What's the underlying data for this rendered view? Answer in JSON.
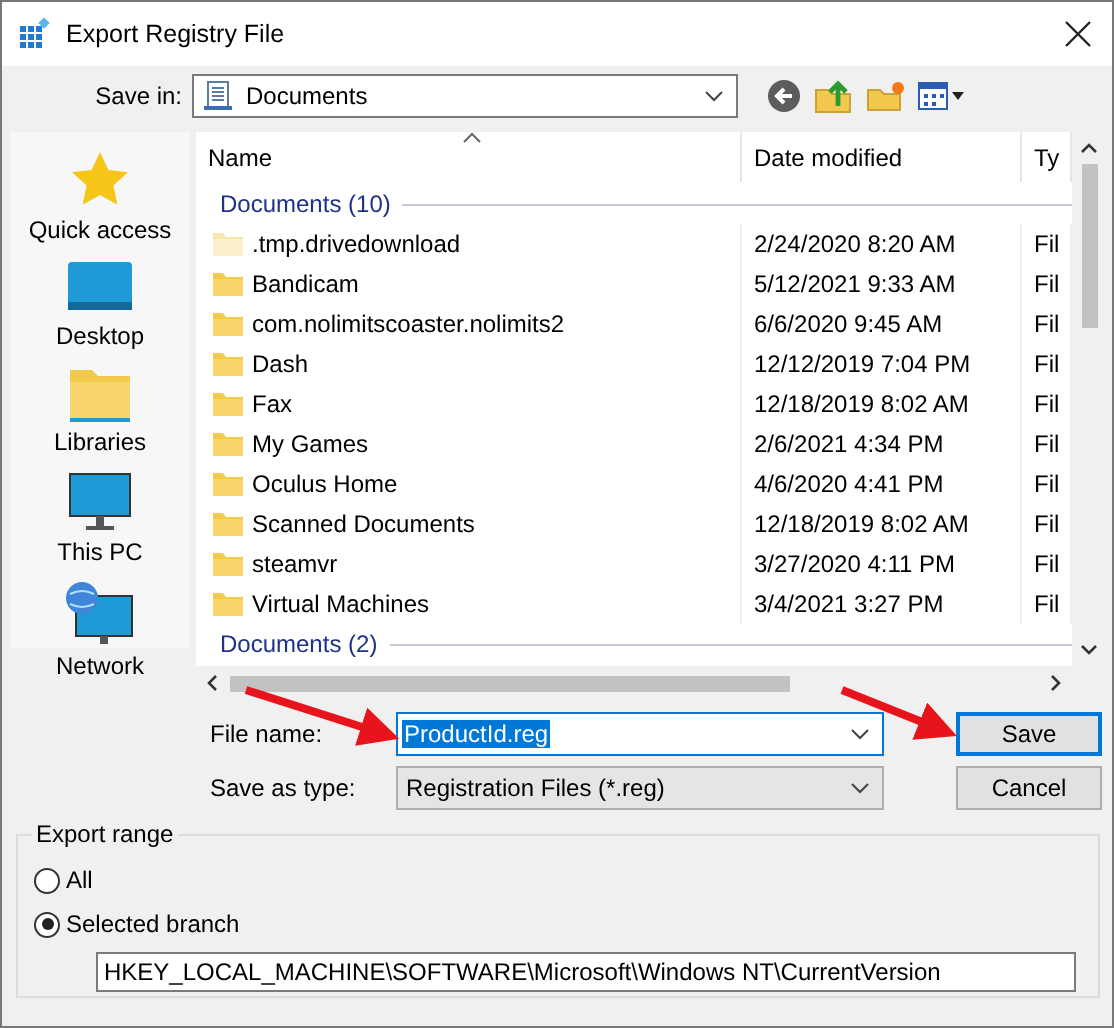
{
  "window": {
    "title": "Export Registry File"
  },
  "save_in": {
    "label": "Save in:",
    "value": "Documents"
  },
  "sidebar": {
    "items": [
      {
        "label": "Quick access",
        "kind": "star"
      },
      {
        "label": "Desktop",
        "kind": "desktop"
      },
      {
        "label": "Libraries",
        "kind": "library"
      },
      {
        "label": "This PC",
        "kind": "pc"
      },
      {
        "label": "Network",
        "kind": "network"
      }
    ]
  },
  "table": {
    "columns": [
      "Name",
      "Date modified",
      "Ty"
    ],
    "rows": [
      {
        "kind": "group",
        "name": "Documents (10)"
      },
      {
        "kind": "folder",
        "hidden": true,
        "name": ".tmp.drivedownload",
        "date": "2/24/2020 8:20 AM",
        "column_3": "Fil"
      },
      {
        "kind": "folder",
        "hidden": false,
        "name": "Bandicam",
        "date": "5/12/2021 9:33 AM",
        "column_3": "Fil"
      },
      {
        "kind": "folder",
        "hidden": false,
        "name": "com.nolimitscoaster.nolimits2",
        "date": "6/6/2020 9:45 AM",
        "column_3": "Fil"
      },
      {
        "kind": "folder",
        "hidden": false,
        "name": "Dash",
        "date": "12/12/2019 7:04 PM",
        "column_3": "Fil"
      },
      {
        "kind": "folder",
        "hidden": false,
        "name": "Fax",
        "date": "12/18/2019 8:02 AM",
        "column_3": "Fil"
      },
      {
        "kind": "folder",
        "hidden": false,
        "name": "My Games",
        "date": "2/6/2021 4:34 PM",
        "column_3": "Fil"
      },
      {
        "kind": "folder",
        "hidden": false,
        "name": "Oculus Home",
        "date": "4/6/2020 4:41 PM",
        "column_3": "Fil"
      },
      {
        "kind": "folder",
        "hidden": false,
        "name": "Scanned Documents",
        "date": "12/18/2019 8:02 AM",
        "column_3": "Fil"
      },
      {
        "kind": "folder",
        "hidden": false,
        "name": "steamvr",
        "date": "3/27/2020 4:11 PM",
        "column_3": "Fil"
      },
      {
        "kind": "folder",
        "hidden": false,
        "name": "Virtual Machines",
        "date": "3/4/2021 3:27 PM",
        "column_3": "Fil"
      },
      {
        "kind": "group",
        "name": "Documents (2)"
      }
    ]
  },
  "file_name": {
    "label": "File name:",
    "value": "ProductId.reg",
    "text_selected": true
  },
  "save_as_type": {
    "label": "Save as type:",
    "value": "Registration Files (*.reg)"
  },
  "buttons": [
    {
      "label": "Save",
      "default": true
    },
    {
      "label": "Cancel",
      "default": false
    }
  ],
  "export_range": {
    "title": "Export range",
    "options": [
      {
        "label": "All",
        "selected": false
      },
      {
        "label": "Selected branch",
        "selected": true
      }
    ],
    "branch_path": "HKEY_LOCAL_MACHINE\\SOFTWARE\\Microsoft\\Windows NT\\CurrentVersion"
  }
}
